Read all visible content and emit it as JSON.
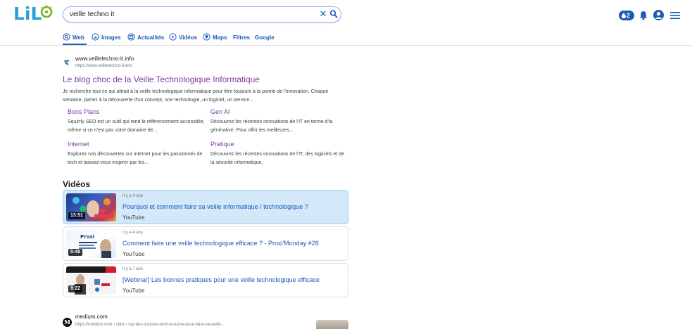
{
  "brand": {
    "logo_text_a": "Li",
    "logo_text_b": "L",
    "logo_text_c": "o"
  },
  "search": {
    "query": "veille techno it",
    "clear_icon": "close-icon",
    "search_icon": "search-icon"
  },
  "header": {
    "drops_count": "2"
  },
  "tabs": [
    {
      "label": "Web",
      "icon": "web-icon",
      "active": true
    },
    {
      "label": "Images",
      "icon": "images-icon"
    },
    {
      "label": "Actualités",
      "icon": "news-icon"
    },
    {
      "label": "Vidéos",
      "icon": "video-icon"
    },
    {
      "label": "Maps",
      "icon": "map-pin-icon"
    },
    {
      "label": "Filtres"
    },
    {
      "label": "Google"
    }
  ],
  "result1": {
    "site_name": "www.veilletechno-it.info",
    "site_url": "https://www.veilletechno-it.info",
    "title": "Le blog choc de la Veille Technologique Informatique",
    "snippet": "Je recherche tout ce qui attrait à la veille technologique informatique pour être toujours à la pointe de l'innovation. Chaque semaine, partez à la découverte d'un concept, une technologie, un logiciel, un service...",
    "sitelinks": [
      {
        "title": "Bons Plans",
        "desc": "Squirrly SEO est un outil qui rend le référencement accessible, même si ce n'est pas votre domaine de..."
      },
      {
        "title": "Gen AI",
        "desc": "Découvrez les récentes innovations de l'IT en terme d'ia générative. Pour offrir les meilleures..."
      },
      {
        "title": "Internet",
        "desc": "Explorez nos découvertes sur internet pour les passionnés de tech et laissez-vous inspirer par les..."
      },
      {
        "title": "Pratique",
        "desc": "Découvrez les récentes innovations de l'IT, des logiciels et de la sécurité informatique."
      }
    ]
  },
  "videos": {
    "heading": "Vidéos",
    "items": [
      {
        "age": "Il y a 4 ans",
        "title": "Pourquoi et comment faire sa veille informatique / technologique ?",
        "source": "YouTube",
        "duration": "13:51"
      },
      {
        "age": "Il y a 4 ans",
        "title": "Comment faire une veille technologique efficace ? - Proxi'Monday #28",
        "source": "YouTube",
        "duration": "5:48"
      },
      {
        "age": "Il y a 7 ans",
        "title": "[Webinar] Les bonnes pratiques pour une veille technologique efficace",
        "source": "YouTube",
        "duration": "9:22"
      }
    ]
  },
  "result2": {
    "favicon_letter": "M",
    "site_name": "medium.com",
    "site_url": "https://medium.com › cbtw › top-des-sources-tech-à-suivre-pour-faire-sa-veille..."
  },
  "colors": {
    "accent": "#1a5bb8",
    "visited_link": "#7b3b9f",
    "highlight": "#d3e8f9"
  }
}
